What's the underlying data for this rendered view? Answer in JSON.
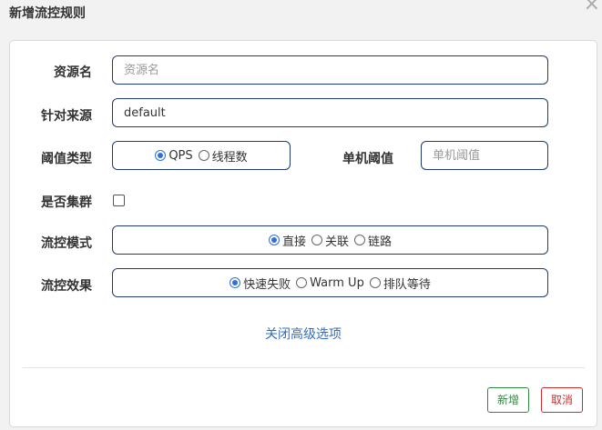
{
  "dialog": {
    "title": "新增流控规则"
  },
  "form": {
    "resource": {
      "label": "资源名",
      "placeholder": "资源名",
      "value": ""
    },
    "limit_app": {
      "label": "针对来源",
      "value": "default"
    },
    "grade": {
      "label": "阈值类型",
      "options": [
        {
          "label": "QPS",
          "checked": true
        },
        {
          "label": "线程数",
          "checked": false
        }
      ]
    },
    "threshold": {
      "label": "单机阈值",
      "placeholder": "单机阈值",
      "value": ""
    },
    "cluster": {
      "label": "是否集群",
      "checked": false
    },
    "strategy": {
      "label": "流控模式",
      "options": [
        {
          "label": "直接",
          "checked": true
        },
        {
          "label": "关联",
          "checked": false
        },
        {
          "label": "链路",
          "checked": false
        }
      ]
    },
    "control_behavior": {
      "label": "流控效果",
      "options": [
        {
          "label": "快速失败",
          "checked": true
        },
        {
          "label": "Warm Up",
          "checked": false
        },
        {
          "label": "排队等待",
          "checked": false
        }
      ]
    },
    "advanced_toggle": "关闭高级选项"
  },
  "footer": {
    "add_label": "新增",
    "cancel_label": "取消"
  },
  "colors": {
    "border": "#1d3b6e",
    "accent": "#2f6fdb",
    "add": "#2e8b3e",
    "cancel": "#c9302c"
  }
}
